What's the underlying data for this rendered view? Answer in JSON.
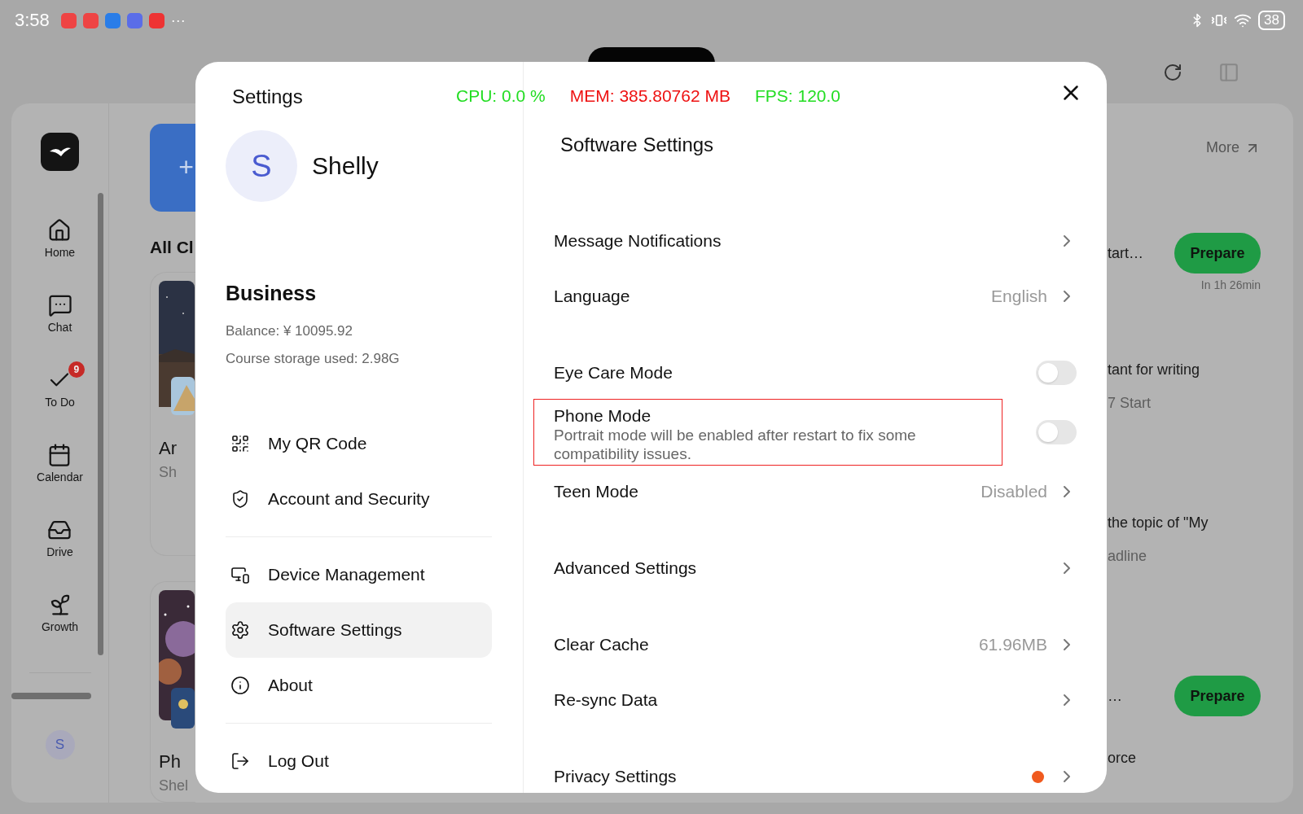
{
  "status_bar": {
    "time": "3:58",
    "more": "···",
    "battery": "38"
  },
  "nav": {
    "items": [
      {
        "label": "Home"
      },
      {
        "label": "Chat"
      },
      {
        "label": "To Do",
        "badge": "9"
      },
      {
        "label": "Calendar"
      },
      {
        "label": "Drive"
      },
      {
        "label": "Growth"
      }
    ],
    "avatar": "S"
  },
  "class_strip": {
    "add": "+",
    "heading": "All Cl",
    "cards": [
      {
        "title": "Ar",
        "owner": "Sh"
      },
      {
        "title": "Ph",
        "owner": "Shel"
      }
    ]
  },
  "feed": {
    "more_link": "More",
    "items": [
      {
        "title": "tart…",
        "button": "Prepare",
        "note": "In 1h 26min"
      },
      {
        "title": "tant for writing",
        "subtitle": "7 Start"
      },
      {
        "title": "the topic of \"My",
        "subtitle": "adline"
      },
      {
        "title": "…",
        "button": "Prepare"
      },
      {
        "title": "orce"
      }
    ]
  },
  "settings_dialog": {
    "title": "Settings",
    "metrics": [
      {
        "text": "CPU: 0.0 %",
        "color": "#22dd22"
      },
      {
        "text": "MEM: 385.80762 MB",
        "color": "#ee1111"
      },
      {
        "text": "FPS: 120.0",
        "color": "#22dd22"
      }
    ],
    "profile": {
      "initial": "S",
      "name": "Shelly"
    },
    "account": {
      "plan": "Business",
      "balance": "Balance: ¥ 10095.92",
      "storage": "Course storage used: 2.98G"
    },
    "menu": [
      [
        {
          "label": "My QR Code",
          "selected": false
        },
        {
          "label": "Account and Security",
          "selected": false
        }
      ],
      [
        {
          "label": "Device Management",
          "selected": false
        },
        {
          "label": "Software Settings",
          "selected": true
        },
        {
          "label": "About",
          "selected": false
        }
      ],
      [
        {
          "label": "Log Out",
          "selected": false
        }
      ]
    ],
    "panel_title": "Software Settings",
    "groups": [
      [
        {
          "kind": "link",
          "label": "Message Notifications"
        },
        {
          "kind": "link",
          "label": "Language",
          "value": "English"
        }
      ],
      [
        {
          "kind": "toggle",
          "label": "Eye Care Mode",
          "on": false
        },
        {
          "kind": "toggle",
          "label": "Phone Mode",
          "description": "Portrait mode will be enabled after restart to fix some compatibility issues.",
          "on": false,
          "highlighted": true
        },
        {
          "kind": "link",
          "label": "Teen Mode",
          "value": "Disabled"
        }
      ],
      [
        {
          "kind": "link",
          "label": "Advanced Settings"
        }
      ],
      [
        {
          "kind": "link",
          "label": "Clear Cache",
          "value": "61.96MB"
        },
        {
          "kind": "link",
          "label": "Re-sync Data"
        }
      ],
      [
        {
          "kind": "link",
          "label": "Privacy Settings",
          "alert": true
        }
      ]
    ]
  }
}
